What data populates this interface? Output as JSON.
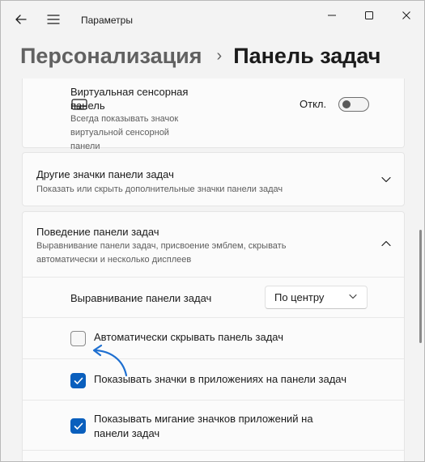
{
  "app": {
    "title": "Параметры"
  },
  "breadcrumb": {
    "parent": "Персонализация",
    "separator": "›",
    "current": "Панель задач"
  },
  "touch_keyboard": {
    "title": "Виртуальная сенсорная панель",
    "title_line1": "Виртуальная сенсорная",
    "title_line2": "панель",
    "description_line1": "Всегда показывать значок",
    "description_line2": "виртуальной сенсорной",
    "description_line3": "панели",
    "toggle_state": "Откл.",
    "icon": "touchpad-icon"
  },
  "other_icons": {
    "title": "Другие значки панели задач",
    "description": "Показать или скрыть дополнительные значки панели задач",
    "icon": "chevron-down-icon"
  },
  "behavior": {
    "title": "Поведение панели задач",
    "description_line1": "Выравнивание панели задач, присвоение эмблем, скрывать",
    "description_line2": "автоматически и несколько дисплеев",
    "icon": "chevron-up-icon",
    "alignment": {
      "label": "Выравнивание панели задач",
      "value": "По центру"
    },
    "options": [
      {
        "label": "Автоматически скрывать панель задач",
        "checked": false
      },
      {
        "label": "Показывать значки в приложениях на панели задач",
        "checked": true
      },
      {
        "label_line1": "Показывать мигание значков приложений на",
        "label_line2": "панели задач",
        "checked": true
      }
    ]
  },
  "colors": {
    "accent": "#0a5fbd",
    "annotation_arrow": "#1e6fd0"
  }
}
